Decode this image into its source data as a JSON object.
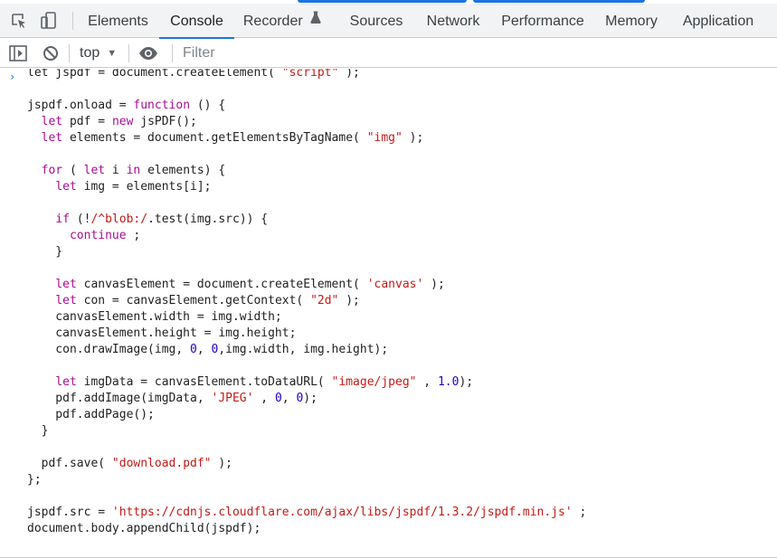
{
  "colors": {
    "accent": "#1a73e8",
    "keyword": "#aa0d91",
    "string": "#c41a16",
    "number": "#1c00cf",
    "text": "#202124"
  },
  "devtools": {
    "left_icons": [
      "inspect-element-icon",
      "device-toolbar-icon"
    ],
    "tabs": [
      {
        "label": "Elements"
      },
      {
        "label": "Console",
        "active": true
      },
      {
        "label": "Recorder",
        "icon": "flask-icon"
      },
      {
        "label": "Sources"
      },
      {
        "label": "Network"
      },
      {
        "label": "Performance"
      },
      {
        "label": "Memory"
      },
      {
        "label": "Application"
      }
    ]
  },
  "console_toolbar": {
    "icons": [
      "sidebar-toggle-icon",
      "clear-console-icon",
      "eye-icon"
    ],
    "context": "top",
    "filter_placeholder": "Filter"
  },
  "console": {
    "prompt_icon": "chevron-right-icon",
    "lines": [
      [
        [
          "t",
          "let jspdf = document.createElement( "
        ],
        [
          "s",
          "\"script\""
        ],
        [
          "t",
          " );"
        ]
      ],
      [],
      [
        [
          "t",
          "jspdf.onload = "
        ],
        [
          "k",
          "function"
        ],
        [
          "t",
          " () {"
        ]
      ],
      [
        [
          "t",
          "  "
        ],
        [
          "k",
          "let"
        ],
        [
          "t",
          " pdf = "
        ],
        [
          "k",
          "new"
        ],
        [
          "t",
          " jsPDF();"
        ]
      ],
      [
        [
          "t",
          "  "
        ],
        [
          "k",
          "let"
        ],
        [
          "t",
          " elements = document.getElementsByTagName( "
        ],
        [
          "s",
          "\"img\""
        ],
        [
          "t",
          " );"
        ]
      ],
      [],
      [
        [
          "t",
          "  "
        ],
        [
          "k",
          "for"
        ],
        [
          "t",
          " ( "
        ],
        [
          "k",
          "let"
        ],
        [
          "t",
          " i "
        ],
        [
          "k",
          "in"
        ],
        [
          "t",
          " elements) {"
        ]
      ],
      [
        [
          "t",
          "    "
        ],
        [
          "k",
          "let"
        ],
        [
          "t",
          " img = elements[i];"
        ]
      ],
      [],
      [
        [
          "t",
          "    "
        ],
        [
          "k",
          "if"
        ],
        [
          "t",
          " (!"
        ],
        [
          "s",
          "/^blob:/"
        ],
        [
          "t",
          ".test(img.src)) {"
        ]
      ],
      [
        [
          "t",
          "      "
        ],
        [
          "k",
          "continue"
        ],
        [
          "t",
          " ;"
        ]
      ],
      [
        [
          "t",
          "    }"
        ]
      ],
      [],
      [
        [
          "t",
          "    "
        ],
        [
          "k",
          "let"
        ],
        [
          "t",
          " canvasElement = document.createElement( "
        ],
        [
          "s",
          "'canvas'"
        ],
        [
          "t",
          " );"
        ]
      ],
      [
        [
          "t",
          "    "
        ],
        [
          "k",
          "let"
        ],
        [
          "t",
          " con = canvasElement.getContext( "
        ],
        [
          "s",
          "\"2d\""
        ],
        [
          "t",
          " );"
        ]
      ],
      [
        [
          "t",
          "    canvasElement.width = img.width;"
        ]
      ],
      [
        [
          "t",
          "    canvasElement.height = img.height;"
        ]
      ],
      [
        [
          "t",
          "    con.drawImage(img, "
        ],
        [
          "n",
          "0"
        ],
        [
          "t",
          ", "
        ],
        [
          "n",
          "0"
        ],
        [
          "t",
          ",img.width, img.height);"
        ]
      ],
      [],
      [
        [
          "t",
          "    "
        ],
        [
          "k",
          "let"
        ],
        [
          "t",
          " imgData = canvasElement.toDataURL( "
        ],
        [
          "s",
          "\"image/jpeg\""
        ],
        [
          "t",
          " , "
        ],
        [
          "n",
          "1.0"
        ],
        [
          "t",
          ");"
        ]
      ],
      [
        [
          "t",
          "    pdf.addImage(imgData, "
        ],
        [
          "s",
          "'JPEG'"
        ],
        [
          "t",
          " , "
        ],
        [
          "n",
          "0"
        ],
        [
          "t",
          ", "
        ],
        [
          "n",
          "0"
        ],
        [
          "t",
          ");"
        ]
      ],
      [
        [
          "t",
          "    pdf.addPage();"
        ]
      ],
      [
        [
          "t",
          "  }"
        ]
      ],
      [],
      [
        [
          "t",
          "  pdf.save( "
        ],
        [
          "s",
          "\"download.pdf\""
        ],
        [
          "t",
          " );"
        ]
      ],
      [
        [
          "t",
          "};"
        ]
      ],
      [],
      [
        [
          "t",
          "jspdf.src = "
        ],
        [
          "s",
          "'https://cdnjs.cloudflare.com/ajax/libs/jspdf/1.3.2/jspdf.min.js'"
        ],
        [
          "t",
          " ;"
        ]
      ],
      [
        [
          "t",
          "document.body.appendChild(jspdf);"
        ]
      ]
    ]
  }
}
